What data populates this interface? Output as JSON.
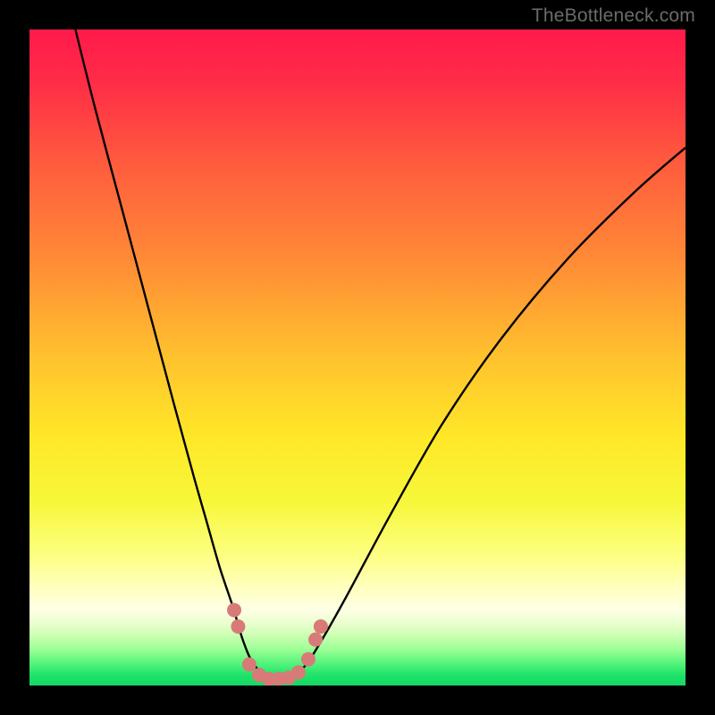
{
  "watermark": {
    "text": "TheBottleneck.com"
  },
  "colors": {
    "frame": "#000000",
    "curve": "#000000",
    "curve_highlight": "#d87a78",
    "gradient_stops": [
      {
        "offset": 0.0,
        "color": "#ff1a4b"
      },
      {
        "offset": 0.08,
        "color": "#ff2c47"
      },
      {
        "offset": 0.2,
        "color": "#ff5a3e"
      },
      {
        "offset": 0.35,
        "color": "#ff8a36"
      },
      {
        "offset": 0.5,
        "color": "#ffc22e"
      },
      {
        "offset": 0.62,
        "color": "#ffe728"
      },
      {
        "offset": 0.72,
        "color": "#f7f73a"
      },
      {
        "offset": 0.8,
        "color": "#fdff80"
      },
      {
        "offset": 0.855,
        "color": "#ffffc4"
      },
      {
        "offset": 0.885,
        "color": "#feffe6"
      },
      {
        "offset": 0.905,
        "color": "#eaffce"
      },
      {
        "offset": 0.925,
        "color": "#c9ffb0"
      },
      {
        "offset": 0.945,
        "color": "#9cff96"
      },
      {
        "offset": 0.965,
        "color": "#58f57c"
      },
      {
        "offset": 0.985,
        "color": "#1de269"
      },
      {
        "offset": 1.0,
        "color": "#16d865"
      }
    ]
  },
  "chart_data": {
    "type": "line",
    "title": "",
    "xlabel": "",
    "ylabel": "",
    "xlim": [
      0,
      100
    ],
    "ylim": [
      0,
      100
    ],
    "series": [
      {
        "name": "bottleneck-curve",
        "x": [
          7,
          10,
          14,
          18,
          22,
          25,
          27,
          29,
          31,
          32.5,
          34,
          36,
          38,
          40,
          42,
          44,
          48,
          55,
          63,
          72,
          82,
          92,
          100
        ],
        "y": [
          100,
          88,
          73,
          58,
          43,
          32,
          25,
          18,
          12,
          7,
          3.5,
          1.5,
          1,
          1.3,
          3,
          6,
          13,
          26,
          40,
          53,
          65,
          75,
          82
        ]
      }
    ],
    "highlight_points": {
      "name": "curve-highlight-dots",
      "x": [
        31.2,
        31.8,
        33.5,
        35,
        36.5,
        38,
        39.5,
        41,
        42.5,
        43.6,
        44.4
      ],
      "y": [
        11.5,
        9.0,
        3.2,
        1.6,
        1.0,
        1.0,
        1.2,
        2.0,
        4.0,
        7.0,
        9.0
      ]
    }
  }
}
